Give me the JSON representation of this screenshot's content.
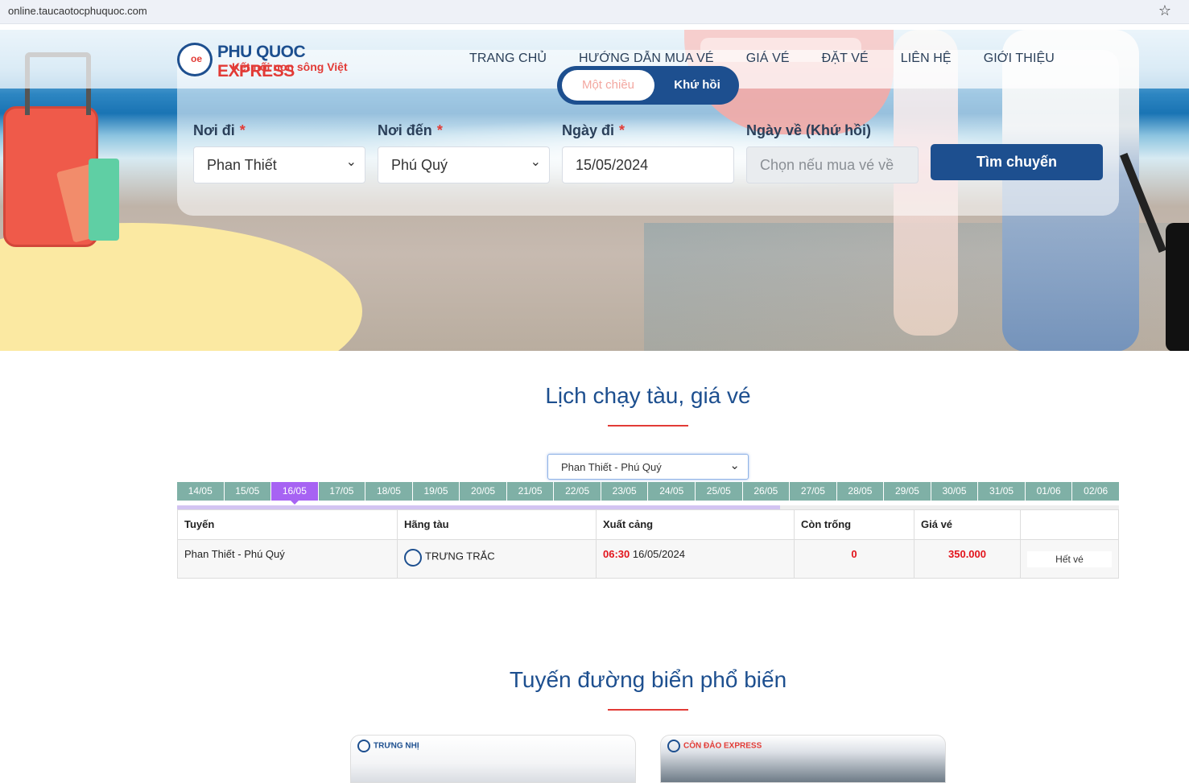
{
  "browser": {
    "url": "online.taucaotocphuquoc.com",
    "bookmark_icon": "star-icon"
  },
  "logo": {
    "brand_part1": "PHU QUOC",
    "brand_part2": " EXPRESS",
    "slogan": "Kết nối non sông Việt"
  },
  "nav": [
    "TRANG CHỦ",
    "HƯỚNG DẪN MUA VÉ",
    "GIÁ VÉ",
    "ĐẶT VÉ",
    "LIÊN HỆ",
    "GIỚI THIỆU"
  ],
  "search": {
    "trip_types": [
      "Một chiều",
      "Khứ hồi"
    ],
    "from_label": "Nơi đi",
    "from_value": "Phan Thiết",
    "to_label": "Nơi đến",
    "to_value": "Phú Quý",
    "depart_label": "Ngày đi",
    "depart_value": "15/05/2024",
    "return_label": "Ngày về (Khứ hồi)",
    "return_placeholder": "Chọn nếu mua vé về",
    "required_mark": "*",
    "search_button": "Tìm chuyến"
  },
  "schedule": {
    "title": "Lịch chạy tàu, giá vé",
    "route_select": "Phan Thiết - Phú Quý",
    "dates": [
      "14/05",
      "15/05",
      "16/05",
      "17/05",
      "18/05",
      "19/05",
      "20/05",
      "21/05",
      "22/05",
      "23/05",
      "24/05",
      "25/05",
      "26/05",
      "27/05",
      "28/05",
      "29/05",
      "30/05",
      "31/05",
      "01/06",
      "02/06"
    ],
    "active_date": "16/05",
    "headers": [
      "Tuyến",
      "Hãng tàu",
      "Xuất cảng",
      "Còn trống",
      "Giá vé",
      ""
    ],
    "row": {
      "route": "Phan Thiết - Phú Quý",
      "operator": "TRƯNG TRẮC",
      "depart_time": "06:30",
      "depart_date": "16/05/2024",
      "seats": "0",
      "price": "350.000",
      "status": "Hết vé"
    }
  },
  "popular": {
    "title": "Tuyến đường biển phổ biến",
    "cards": [
      "TRƯNG NHỊ",
      "CÔN ĐẢO EXPRESS"
    ]
  }
}
